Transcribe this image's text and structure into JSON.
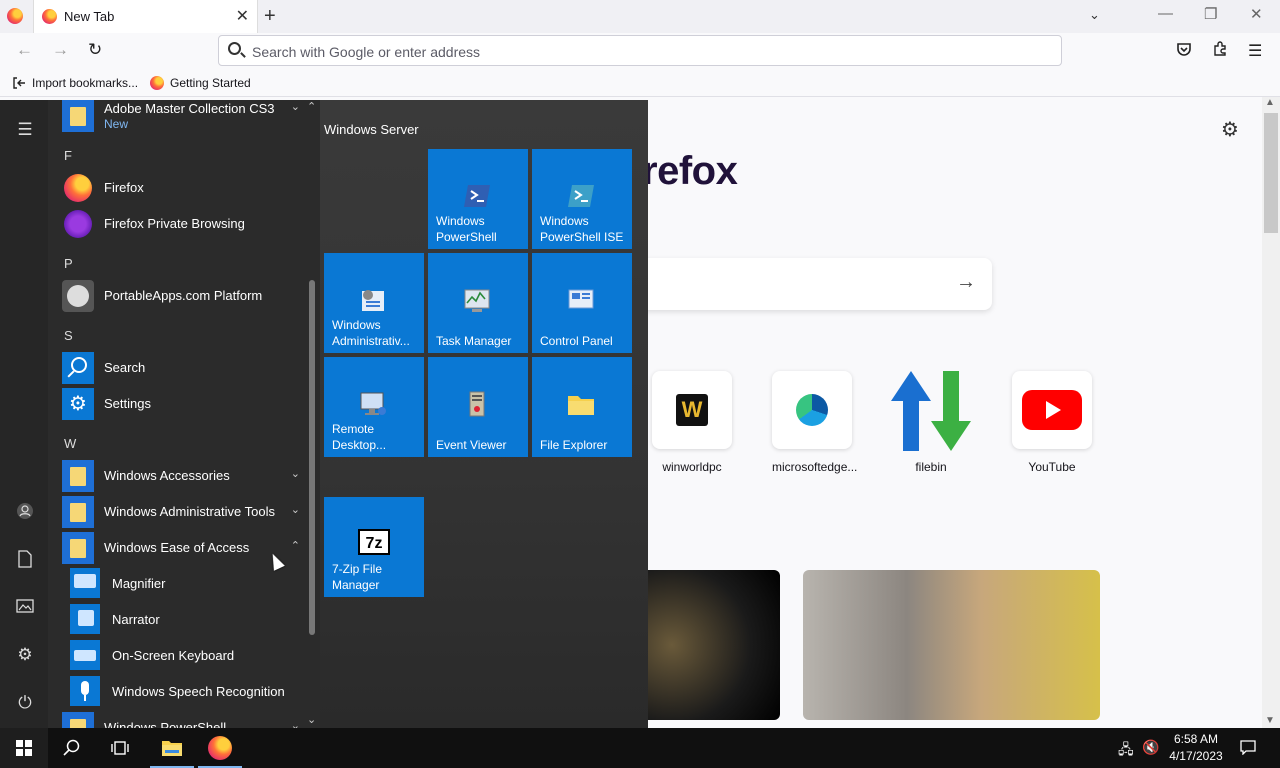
{
  "browser": {
    "tab_title": "New Tab",
    "address_placeholder": "Search with Google or enter address",
    "bookmarks": [
      "Import bookmarks...",
      "Getting Started"
    ],
    "brand_text": "refox",
    "top_sites": [
      {
        "label": "winworldpc"
      },
      {
        "label": "microsoftedge..."
      },
      {
        "label": "filebin"
      },
      {
        "label": "YouTube"
      }
    ]
  },
  "start_menu": {
    "apps": [
      {
        "label": "Adobe Master Collection CS3",
        "sub": "New"
      },
      {
        "header": "F"
      },
      {
        "label": "Firefox"
      },
      {
        "label": "Firefox Private Browsing"
      },
      {
        "header": "P"
      },
      {
        "label": "PortableApps.com Platform"
      },
      {
        "header": "S"
      },
      {
        "label": "Search"
      },
      {
        "label": "Settings"
      },
      {
        "header": "W"
      },
      {
        "label": "Windows Accessories"
      },
      {
        "label": "Windows Administrative Tools"
      },
      {
        "label": "Windows Ease of Access"
      },
      {
        "label": "Magnifier"
      },
      {
        "label": "Narrator"
      },
      {
        "label": "On-Screen Keyboard"
      },
      {
        "label": "Windows Speech Recognition"
      },
      {
        "label": "Windows PowerShell"
      }
    ],
    "tile_group": "Windows Server",
    "tiles": [
      {
        "label": "Windows\nPowerShell"
      },
      {
        "label": "Windows\nPowerShell ISE"
      },
      {
        "label": "Windows\nAdministrativ..."
      },
      {
        "label": "Task Manager"
      },
      {
        "label": "Control Panel"
      },
      {
        "label": "Remote\nDesktop..."
      },
      {
        "label": "Event Viewer"
      },
      {
        "label": "File Explorer"
      },
      {
        "label": "7-Zip File\nManager"
      }
    ]
  },
  "taskbar": {
    "time": "6:58 AM",
    "date": "4/17/2023"
  }
}
